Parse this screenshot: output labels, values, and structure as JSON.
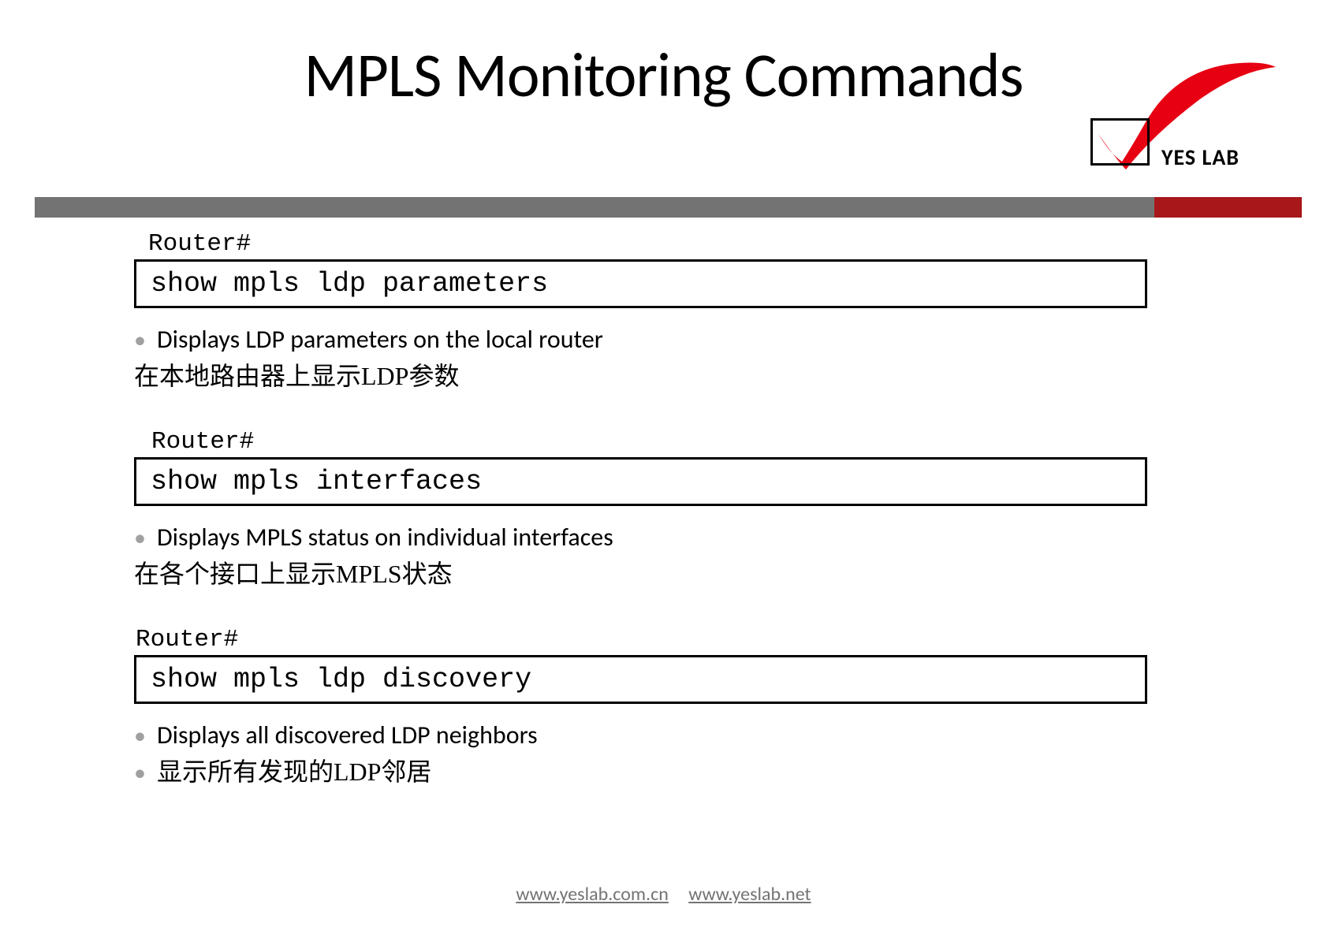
{
  "title": "MPLS Monitoring Commands",
  "logo": {
    "text": "YES LAB",
    "accent_color": "#e60012"
  },
  "bars": {
    "gray": "#737373",
    "red": "#a8171a"
  },
  "sections": [
    {
      "prompt": "Router#",
      "command": "show mpls ldp parameters",
      "bullets": [
        {
          "text": "Displays LDP parameters on the local router",
          "lang": "en"
        }
      ],
      "plain": "在本地路由器上显示LDP参数"
    },
    {
      "prompt": "Router#",
      "command": "show mpls interfaces",
      "bullets": [
        {
          "text": "Displays MPLS status on individual interfaces",
          "lang": "en"
        }
      ],
      "plain": "在各个接口上显示MPLS状态"
    },
    {
      "prompt": "Router#",
      "command": "show mpls ldp discovery",
      "bullets": [
        {
          "text": "Displays all discovered LDP neighbors",
          "lang": "en"
        },
        {
          "text": "显示所有发现的LDP邻居",
          "lang": "cn"
        }
      ],
      "plain": ""
    }
  ],
  "footer": {
    "link1": "www.yeslab.com.cn",
    "link2": "www.yeslab.net"
  }
}
